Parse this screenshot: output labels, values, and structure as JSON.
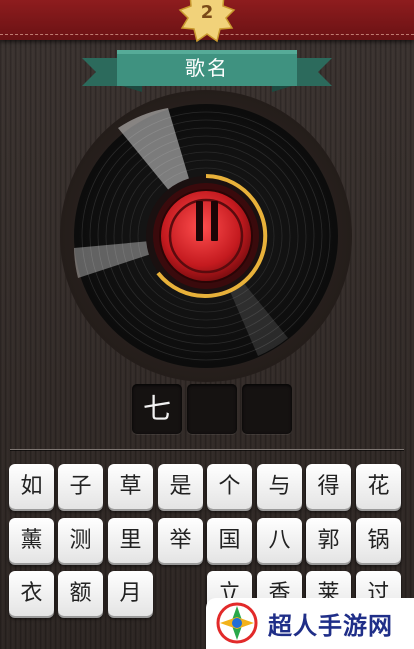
{
  "header": {
    "level": "2"
  },
  "ribbon": {
    "title": "歌名"
  },
  "player": {
    "state": "paused"
  },
  "answer": {
    "slots": [
      "七",
      "",
      ""
    ]
  },
  "keyboard": {
    "row1": [
      "如",
      "子",
      "草",
      "是",
      "个",
      "与",
      "得",
      "花"
    ],
    "row2": [
      "薰",
      "测",
      "里",
      "举",
      "国",
      "八",
      "郭",
      "锅"
    ],
    "row3": [
      "衣",
      "额",
      "月",
      "",
      "立",
      "香",
      "莱",
      "过"
    ]
  },
  "watermark": {
    "text": "超人手游网"
  },
  "colors": {
    "banner": "#7e1719",
    "ribbon": "#3d8c7b",
    "record_center": "#d8232a",
    "progress_arc": "#e8b13a"
  }
}
